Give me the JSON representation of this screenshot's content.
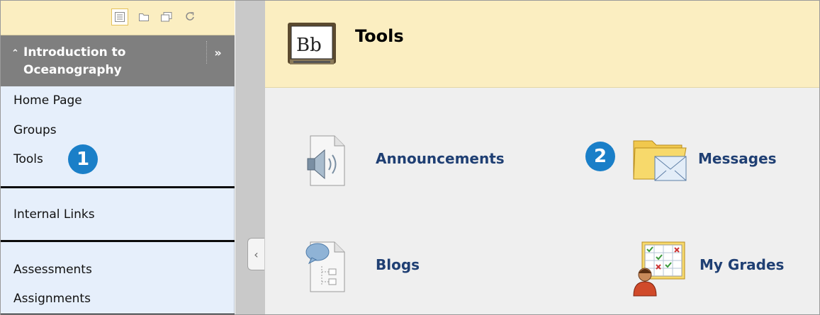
{
  "sidebar": {
    "toolbar": {
      "icons": [
        "list-view-icon",
        "folder-view-icon",
        "window-icon",
        "refresh-icon"
      ]
    },
    "course_title": "Introduction to Oceanography",
    "course_title_line1": "Introduction to",
    "course_title_line2": "Oceanography",
    "expand_label": "»",
    "collapse_chevron": "⌃",
    "items": [
      {
        "label": "Home Page"
      },
      {
        "label": "Groups"
      },
      {
        "label": "Tools"
      },
      {
        "label": "Internal Links"
      },
      {
        "label": "Assessments"
      },
      {
        "label": "Assignments"
      }
    ],
    "step_badge": "1"
  },
  "collapse_button": "‹",
  "main": {
    "title": "Tools",
    "logo_text": "Bb",
    "tools": [
      {
        "label": "Announcements",
        "icon": "announcements-speaker-icon"
      },
      {
        "label": "Messages",
        "icon": "messages-folder-envelope-icon"
      },
      {
        "label": "Blogs",
        "icon": "blogs-icon"
      },
      {
        "label": "My Grades",
        "icon": "my-grades-icon"
      }
    ],
    "step_badge": "2"
  },
  "colors": {
    "header_bg": "#fbeec1",
    "sidebar_bg": "#e6effb",
    "course_header_bg": "#7f7f7f",
    "link_color": "#1f3f73",
    "badge_blue": "#1a7fc8"
  }
}
